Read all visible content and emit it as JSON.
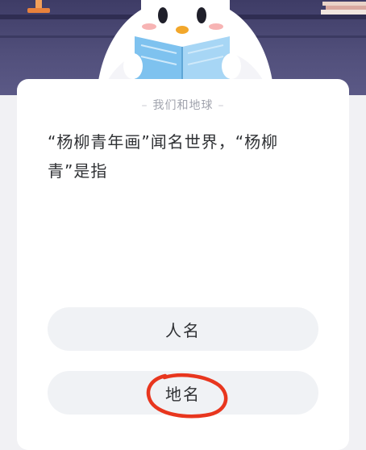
{
  "quiz": {
    "topic": "我们和地球",
    "question": "“杨柳青年画”闻名世界，“杨柳青”是指",
    "options": [
      {
        "label": "人名"
      },
      {
        "label": "地名"
      }
    ]
  },
  "colors": {
    "header_bg": "#45436e",
    "card_bg": "#ffffff",
    "option_bg": "#f0f2f5",
    "annotation_red": "#e8361e"
  },
  "icons": [
    "lamp-icon",
    "books-icon",
    "mascot-penguin-icon",
    "topic-dash-icon"
  ]
}
